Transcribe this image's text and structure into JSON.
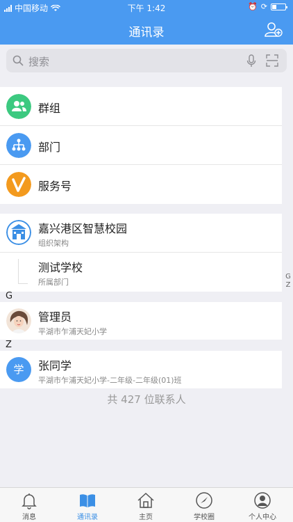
{
  "status_bar": {
    "carrier": "中国移动",
    "time": "下午 1:42"
  },
  "nav": {
    "title": "通讯录",
    "add_icon": "add-contact-icon"
  },
  "search": {
    "placeholder": "搜索"
  },
  "quick_entries": [
    {
      "label": "群组",
      "icon": "group-icon",
      "color": "#3cc980"
    },
    {
      "label": "部门",
      "icon": "org-chart-icon",
      "color": "#4a9af1"
    },
    {
      "label": "服务号",
      "icon": "service-v-icon",
      "color": "#f39a1e"
    }
  ],
  "org": [
    {
      "name": "嘉兴港区智慧校园",
      "sub": "组织架构"
    },
    {
      "name": "测试学校",
      "sub": "所属部门"
    }
  ],
  "sections": [
    {
      "letter": "G",
      "name": "管理员",
      "sub": "平湖市乍浦天妃小学"
    },
    {
      "letter": "Z",
      "name": "张同学",
      "sub": "平湖市乍浦天妃小学-二年级-二年级(01)班",
      "avatar_text": "学"
    }
  ],
  "index_letters": [
    "G",
    "Z"
  ],
  "total": "共 427 位联系人",
  "tabs": [
    {
      "label": "消息",
      "icon": "bell-icon"
    },
    {
      "label": "通讯录",
      "icon": "book-icon",
      "active": true
    },
    {
      "label": "主页",
      "icon": "home-icon"
    },
    {
      "label": "学校圈",
      "icon": "compass-icon"
    },
    {
      "label": "个人中心",
      "icon": "user-icon"
    }
  ],
  "colors": {
    "primary": "#4a9af1",
    "active_tab": "#3b8fe5"
  }
}
